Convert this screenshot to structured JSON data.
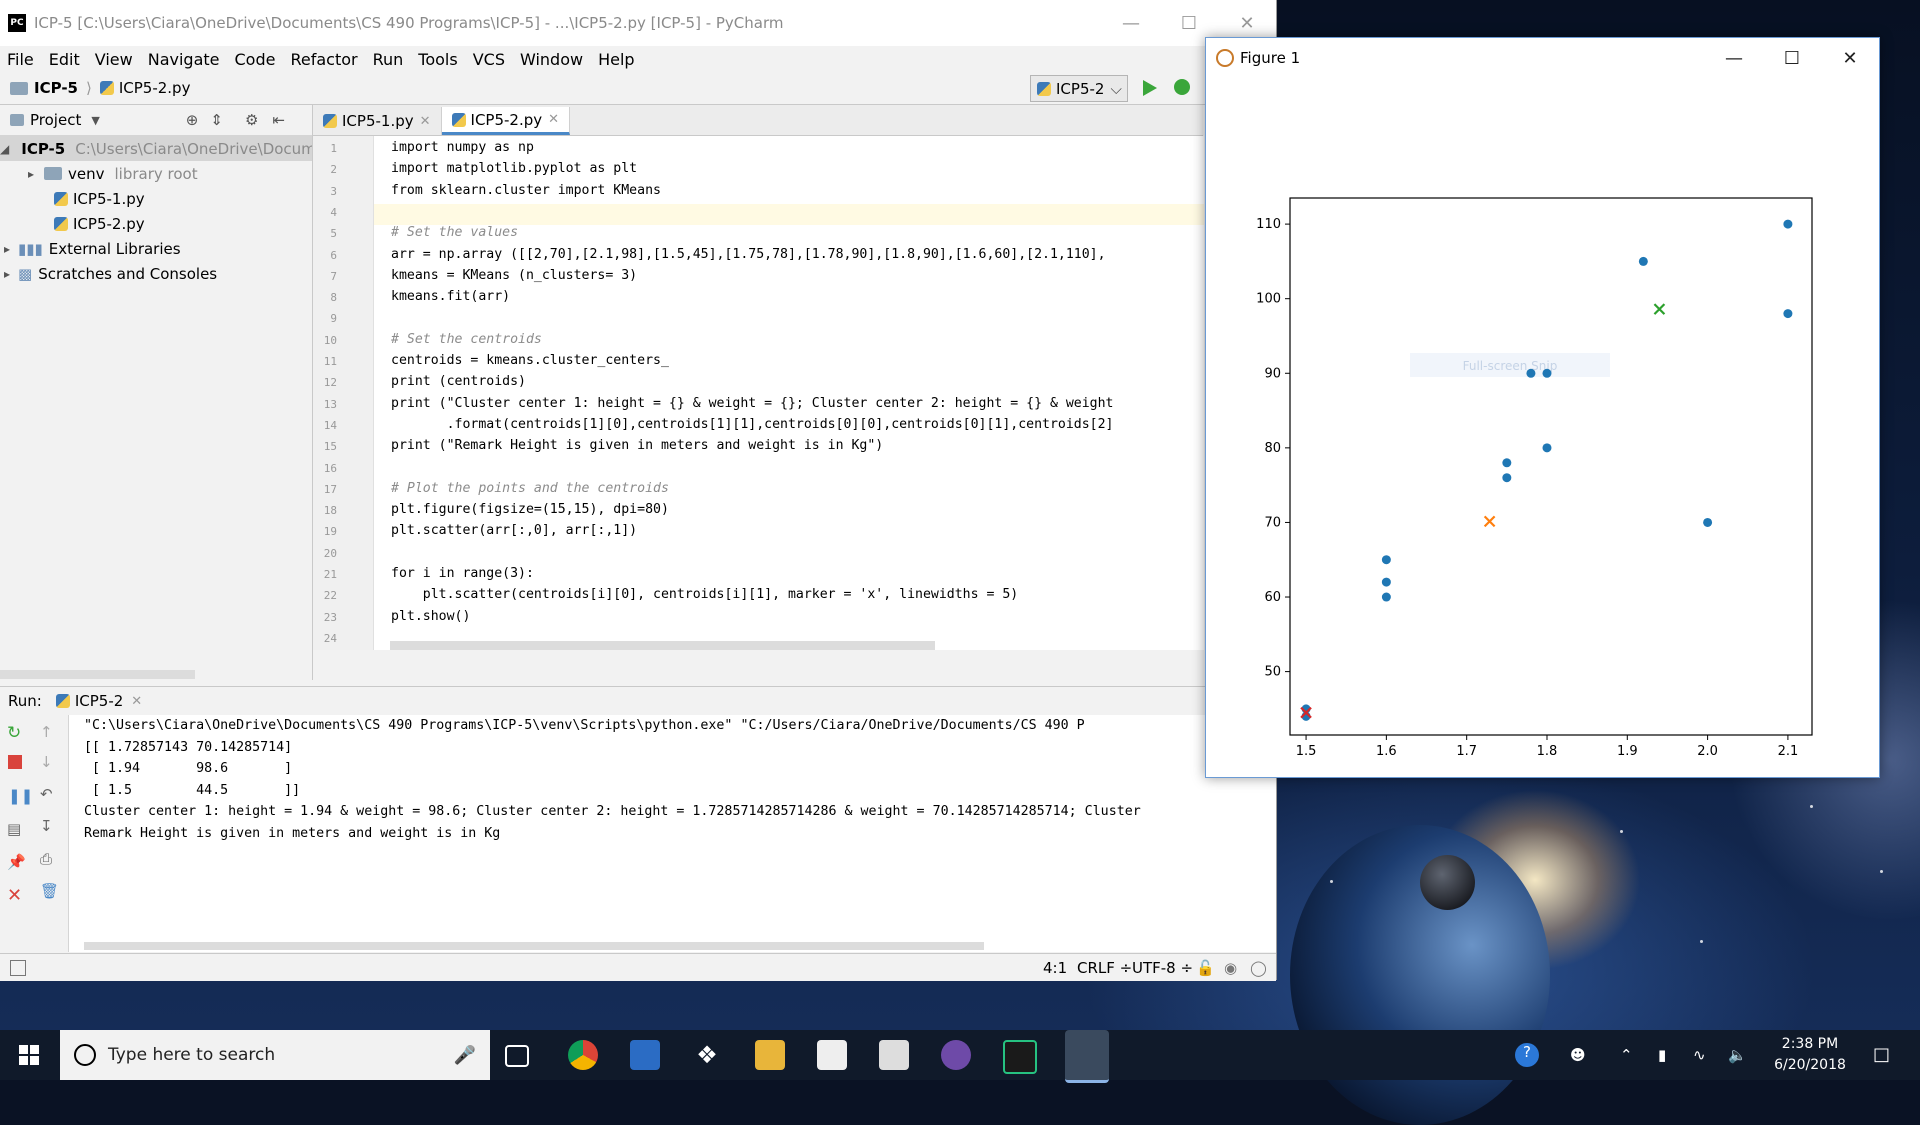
{
  "ide": {
    "title": "ICP-5 [C:\\Users\\Ciara\\OneDrive\\Documents\\CS 490 Programs\\ICP-5] - ...\\ICP5-2.py [ICP-5] - PyCharm",
    "menu": [
      "File",
      "Edit",
      "View",
      "Navigate",
      "Code",
      "Refactor",
      "Run",
      "Tools",
      "VCS",
      "Window",
      "Help"
    ],
    "breadcrumb": {
      "project": "ICP-5",
      "file": "ICP5-2.py"
    },
    "run_config": "ICP5-2",
    "project_panel": {
      "header": "Project",
      "items": [
        {
          "label": "ICP-5",
          "note": "C:\\Users\\Ciara\\OneDrive\\Documents"
        },
        {
          "label": "venv",
          "note": "library root"
        },
        {
          "label": "ICP5-1.py",
          "note": ""
        },
        {
          "label": "ICP5-2.py",
          "note": ""
        },
        {
          "label": "External Libraries",
          "note": ""
        },
        {
          "label": "Scratches and Consoles",
          "note": ""
        }
      ]
    },
    "tabs": [
      {
        "label": "ICP5-1.py"
      },
      {
        "label": "ICP5-2.py"
      }
    ],
    "code_lines": [
      "import numpy as np",
      "import matplotlib.pyplot as plt",
      "from sklearn.cluster import KMeans",
      "",
      "# Set the values",
      "arr = np.array ([[2,70],[2.1,98],[1.5,45],[1.75,78],[1.78,90],[1.8,90],[1.6,60],[2.1,110],",
      "kmeans = KMeans (n_clusters= 3)",
      "kmeans.fit(arr)",
      "",
      "# Set the centroids",
      "centroids = kmeans.cluster_centers_",
      "print (centroids)",
      "print (\"Cluster center 1: height = {} & weight = {}; Cluster center 2: height = {} & weight",
      "       .format(centroids[1][0],centroids[1][1],centroids[0][0],centroids[0][1],centroids[2]",
      "print (\"Remark Height is given in meters and weight is in Kg\")",
      "",
      "# Plot the points and the centroids",
      "plt.figure(figsize=(15,15), dpi=80)",
      "plt.scatter(arr[:,0], arr[:,1])",
      "",
      "for i in range(3):",
      "    plt.scatter(centroids[i][0], centroids[i][1], marker = 'x', linewidths = 5)",
      "plt.show()",
      ""
    ],
    "line_numbers": [
      "1",
      "2",
      "3",
      "4",
      "5",
      "6",
      "7",
      "8",
      "9",
      "10",
      "11",
      "12",
      "13",
      "14",
      "15",
      "16",
      "17",
      "18",
      "19",
      "20",
      "21",
      "22",
      "23",
      "24"
    ],
    "run": {
      "label": "Run:",
      "tab": "ICP5-2",
      "output": [
        "\"C:\\Users\\Ciara\\OneDrive\\Documents\\CS 490 Programs\\ICP-5\\venv\\Scripts\\python.exe\" \"C:/Users/Ciara/OneDrive/Documents/CS 490 P",
        "[[ 1.72857143 70.14285714]",
        " [ 1.94       98.6       ]",
        " [ 1.5        44.5       ]]",
        "Cluster center 1: height = 1.94 & weight = 98.6; Cluster center 2: height = 1.7285714285714286 & weight = 70.14285714285714; Cluster",
        "Remark Height is given in meters and weight is in Kg"
      ]
    },
    "status": {
      "position": "4:1",
      "line_sep": "CRLF ÷",
      "encoding": "UTF-8 ÷"
    }
  },
  "figure": {
    "title": "Figure 1",
    "overlay_hint": "Full-screen Snip"
  },
  "chart_data": {
    "type": "scatter",
    "title": "",
    "xlabel": "",
    "ylabel": "",
    "xlim": [
      1.48,
      2.13
    ],
    "ylim": [
      41.5,
      113.5
    ],
    "xticks": [
      1.5,
      1.6,
      1.7,
      1.8,
      1.9,
      2.0,
      2.1
    ],
    "xtick_labels": [
      "1.5",
      "1.6",
      "1.7",
      "1.8",
      "1.9",
      "2.0",
      "2.1"
    ],
    "yticks": [
      50,
      60,
      70,
      80,
      90,
      100,
      110
    ],
    "ytick_labels": [
      "50",
      "60",
      "70",
      "80",
      "90",
      "100",
      "110"
    ],
    "grid": false,
    "series": [
      {
        "marker": "o",
        "color": "#1f77b4",
        "x": [
          2.0,
          2.1,
          1.5,
          1.75,
          1.78,
          1.8,
          1.6,
          2.1,
          1.92,
          1.75,
          1.6,
          1.8,
          1.6,
          1.5
        ],
        "y": [
          70,
          98,
          45,
          78,
          90,
          90,
          60,
          110,
          105,
          76,
          62,
          80,
          65,
          44
        ]
      },
      {
        "marker": "x",
        "color": "#ff7f0e",
        "x": [
          1.72857143
        ],
        "y": [
          70.14285714
        ]
      },
      {
        "marker": "x",
        "color": "#2ca02c",
        "x": [
          1.94
        ],
        "y": [
          98.6
        ]
      },
      {
        "marker": "x",
        "color": "#d62728",
        "x": [
          1.5
        ],
        "y": [
          44.5
        ]
      }
    ]
  },
  "taskbar": {
    "search_placeholder": "Type here to search",
    "time": "2:38 PM",
    "date": "6/20/2018",
    "apps": [
      "task-view-icon",
      "chrome-icon",
      "store-icon",
      "dropbox-icon",
      "file-explorer-icon",
      "mail-icon",
      "photos-icon",
      "github-icon",
      "pycharm-icon",
      "matplotlib-icon"
    ]
  }
}
